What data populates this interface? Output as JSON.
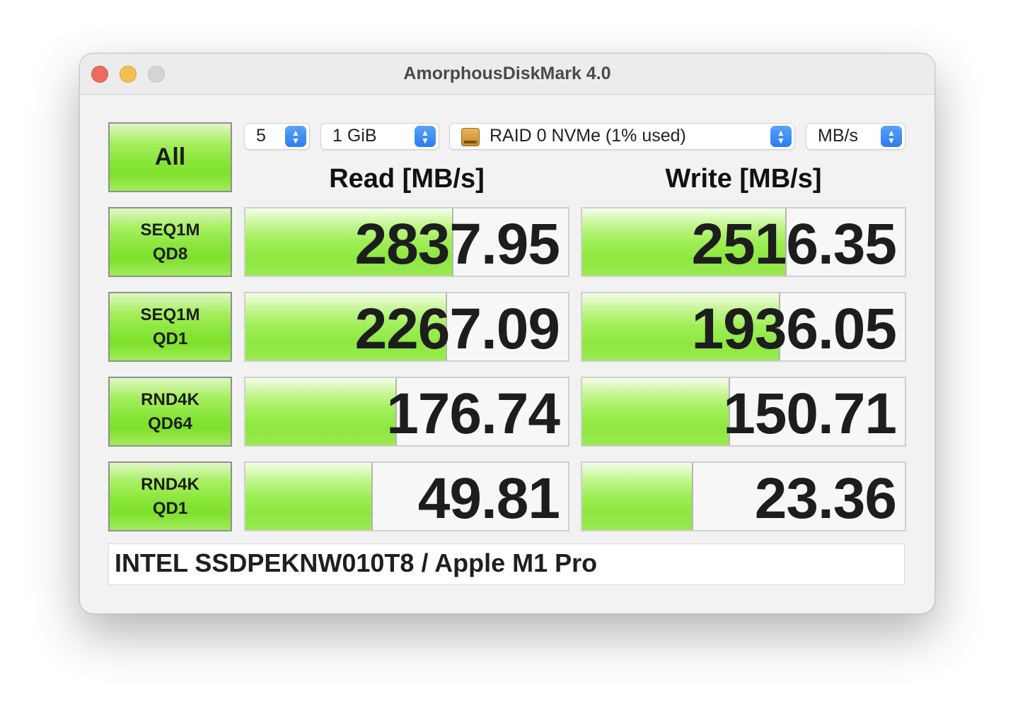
{
  "window": {
    "title": "AmorphousDiskMark 4.0"
  },
  "controls": {
    "all_label": "All",
    "count": "5",
    "size": "1 GiB",
    "drive": "RAID 0 NVMe (1% used)",
    "unit": "MB/s"
  },
  "headers": {
    "read": "Read [MB/s]",
    "write": "Write [MB/s]"
  },
  "tests": [
    {
      "line1": "SEQ1M",
      "line2": "QD8",
      "read": "2837.95",
      "write": "2516.35",
      "read_fill": 0.64,
      "write_fill": 0.63
    },
    {
      "line1": "SEQ1M",
      "line2": "QD1",
      "read": "2267.09",
      "write": "1936.05",
      "read_fill": 0.62,
      "write_fill": 0.61
    },
    {
      "line1": "RND4K",
      "line2": "QD64",
      "read": "176.74",
      "write": "150.71",
      "read_fill": 0.465,
      "write_fill": 0.455
    },
    {
      "line1": "RND4K",
      "line2": "QD1",
      "read": "49.81",
      "write": "23.36",
      "read_fill": 0.39,
      "write_fill": 0.34
    }
  ],
  "comment": "INTEL SSDPEKNW010T8 / Apple M1 Pro",
  "colors": {
    "accent_green": "#8ee740",
    "stepper_blue": "#2b7cf0",
    "close": "#ed6a5e",
    "minimize": "#f5bf4f",
    "zoom_disabled": "#d4d4d4"
  },
  "icons": [
    "close-icon",
    "minimize-icon",
    "zoom-icon",
    "drive-icon",
    "stepper-icon"
  ]
}
